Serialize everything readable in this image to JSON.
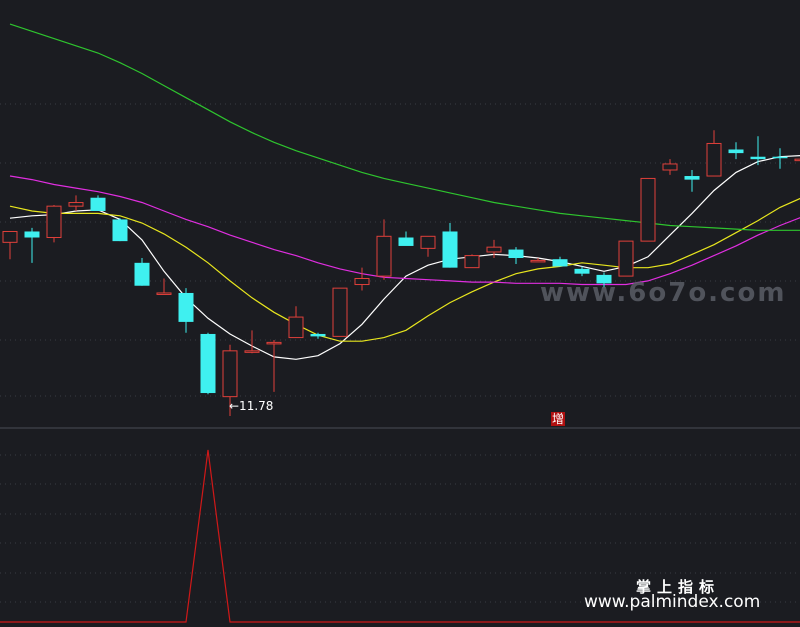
{
  "watermark_1": "www.6o7o.com",
  "watermark_2": "掌上指标",
  "watermark_3": "www.palmindex.com",
  "annotations": {
    "low_label": "←11.78",
    "signal_label": "增"
  },
  "colors": {
    "background": "#1b1c21",
    "up_candle": "#e0403a",
    "down_candle": "#3ff0f0",
    "ma_white": "#ffffff",
    "ma_yellow": "#e8e61e",
    "ma_magenta": "#e02ee0",
    "ma_green": "#2ec42e",
    "indicator": "#d01818",
    "grid": "#3a3c44"
  },
  "chart_data": [
    {
      "type": "candlestick",
      "title": "",
      "price_range": [
        11.3,
        14.85
      ],
      "candles": [
        {
          "o": 12.84,
          "h": 12.89,
          "l": 12.7,
          "c": 12.93
        },
        {
          "o": 12.93,
          "h": 12.96,
          "l": 12.67,
          "c": 12.88
        },
        {
          "o": 12.88,
          "h": 13.15,
          "l": 12.84,
          "c": 13.14
        },
        {
          "o": 13.14,
          "h": 13.23,
          "l": 13.1,
          "c": 13.17
        },
        {
          "o": 13.21,
          "h": 13.23,
          "l": 13.1,
          "c": 13.1
        },
        {
          "o": 13.03,
          "h": 13.04,
          "l": 12.85,
          "c": 12.85
        },
        {
          "o": 12.67,
          "h": 12.71,
          "l": 12.48,
          "c": 12.48
        },
        {
          "o": 12.41,
          "h": 12.54,
          "l": 12.41,
          "c": 12.42
        },
        {
          "o": 12.42,
          "h": 12.46,
          "l": 12.09,
          "c": 12.18
        },
        {
          "o": 12.08,
          "h": 12.09,
          "l": 11.58,
          "c": 11.59
        },
        {
          "o": 11.56,
          "h": 11.99,
          "l": 11.4,
          "c": 11.94
        },
        {
          "o": 11.94,
          "h": 12.11,
          "l": 11.92,
          "c": 11.94
        },
        {
          "o": 12.01,
          "h": 12.03,
          "l": 11.6,
          "c": 12.01
        },
        {
          "o": 12.05,
          "h": 12.31,
          "l": 12.05,
          "c": 12.22
        },
        {
          "o": 12.08,
          "h": 12.09,
          "l": 12.04,
          "c": 12.06
        },
        {
          "o": 12.06,
          "h": 12.43,
          "l": 12.06,
          "c": 12.46
        },
        {
          "o": 12.49,
          "h": 12.63,
          "l": 12.44,
          "c": 12.54
        },
        {
          "o": 12.56,
          "h": 13.03,
          "l": 12.53,
          "c": 12.89
        },
        {
          "o": 12.88,
          "h": 12.93,
          "l": 12.84,
          "c": 12.81
        },
        {
          "o": 12.79,
          "h": 12.81,
          "l": 12.72,
          "c": 12.89
        },
        {
          "o": 12.93,
          "h": 13.0,
          "l": 12.63,
          "c": 12.63
        },
        {
          "o": 12.63,
          "h": 12.74,
          "l": 12.63,
          "c": 12.73
        },
        {
          "o": 12.76,
          "h": 12.86,
          "l": 12.71,
          "c": 12.8
        },
        {
          "o": 12.78,
          "h": 12.8,
          "l": 12.66,
          "c": 12.71
        },
        {
          "o": 12.69,
          "h": 12.71,
          "l": 12.69,
          "c": 12.69
        },
        {
          "o": 12.7,
          "h": 12.72,
          "l": 12.64,
          "c": 12.64
        },
        {
          "o": 12.62,
          "h": 12.64,
          "l": 12.56,
          "c": 12.58
        },
        {
          "o": 12.57,
          "h": 12.59,
          "l": 12.46,
          "c": 12.5
        },
        {
          "o": 12.56,
          "h": 12.85,
          "l": 12.57,
          "c": 12.85
        },
        {
          "o": 12.85,
          "h": 13.37,
          "l": 12.85,
          "c": 13.37
        },
        {
          "o": 13.44,
          "h": 13.53,
          "l": 13.4,
          "c": 13.49
        },
        {
          "o": 13.39,
          "h": 13.44,
          "l": 13.26,
          "c": 13.36
        },
        {
          "o": 13.39,
          "h": 13.77,
          "l": 13.39,
          "c": 13.66
        },
        {
          "o": 13.61,
          "h": 13.67,
          "l": 13.53,
          "c": 13.58
        },
        {
          "o": 13.55,
          "h": 13.72,
          "l": 13.48,
          "c": 13.53
        },
        {
          "o": 13.55,
          "h": 13.62,
          "l": 13.45,
          "c": 13.54
        },
        {
          "o": 13.53,
          "h": 13.55,
          "l": 13.5,
          "c": 13.53
        }
      ],
      "moving_averages": [
        {
          "color": "white",
          "values": [
            13.04,
            13.06,
            13.07,
            13.1,
            13.11,
            13.03,
            12.86,
            12.6,
            12.38,
            12.21,
            12.08,
            11.98,
            11.89,
            11.87,
            11.9,
            12.0,
            12.16,
            12.37,
            12.56,
            12.65,
            12.7,
            12.72,
            12.74,
            12.73,
            12.71,
            12.68,
            12.64,
            12.6,
            12.64,
            12.72,
            12.9,
            13.08,
            13.27,
            13.42,
            13.51,
            13.55,
            13.56
          ]
        },
        {
          "color": "yellow",
          "values": [
            13.14,
            13.1,
            13.08,
            13.08,
            13.08,
            13.06,
            13.0,
            12.91,
            12.8,
            12.67,
            12.52,
            12.38,
            12.26,
            12.16,
            12.07,
            12.02,
            12.02,
            12.05,
            12.11,
            12.23,
            12.34,
            12.43,
            12.51,
            12.58,
            12.62,
            12.64,
            12.67,
            12.65,
            12.63,
            12.63,
            12.66,
            12.74,
            12.82,
            12.92,
            13.02,
            13.13,
            13.21
          ]
        },
        {
          "color": "magenta",
          "values": [
            13.39,
            13.36,
            13.32,
            13.29,
            13.26,
            13.22,
            13.17,
            13.1,
            13.03,
            12.97,
            12.9,
            12.84,
            12.78,
            12.73,
            12.67,
            12.62,
            12.58,
            12.55,
            12.54,
            12.53,
            12.52,
            12.51,
            12.51,
            12.5,
            12.5,
            12.5,
            12.49,
            12.49,
            12.49,
            12.52,
            12.58,
            12.65,
            12.73,
            12.81,
            12.9,
            12.98,
            13.05
          ]
        },
        {
          "color": "green",
          "values": [
            14.65,
            14.59,
            14.53,
            14.47,
            14.41,
            14.33,
            14.24,
            14.14,
            14.04,
            13.94,
            13.84,
            13.75,
            13.67,
            13.6,
            13.54,
            13.48,
            13.42,
            13.37,
            13.33,
            13.29,
            13.25,
            13.21,
            13.17,
            13.14,
            13.11,
            13.08,
            13.06,
            13.04,
            13.02,
            13.0,
            12.98,
            12.97,
            12.96,
            12.95,
            12.94,
            12.94,
            12.94
          ]
        }
      ]
    },
    {
      "type": "line",
      "title": "",
      "y_range": [
        0,
        1
      ],
      "values": [
        0,
        0,
        0,
        0,
        0,
        0,
        0,
        0,
        0,
        1,
        0,
        0,
        0,
        0,
        0,
        0,
        0,
        0,
        0,
        0,
        0,
        0,
        0,
        0,
        0,
        0,
        0,
        0,
        0,
        0,
        0,
        0,
        0,
        0,
        0,
        0,
        0
      ]
    }
  ]
}
